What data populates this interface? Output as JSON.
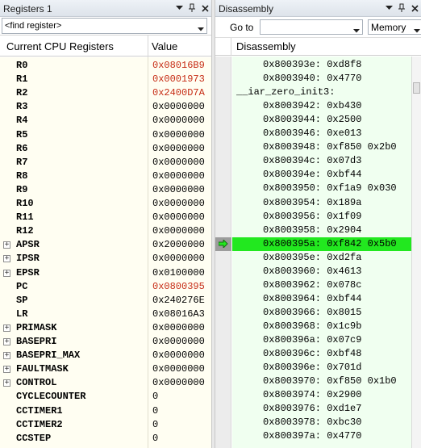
{
  "registers": {
    "title": "Registers 1",
    "find_placeholder": "<find register>",
    "col_name": "Current CPU Registers",
    "col_value": "Value",
    "rows": [
      {
        "name": "R0",
        "value": "0x08016B9",
        "expand": "",
        "changed": true
      },
      {
        "name": "R1",
        "value": "0x0001973",
        "expand": "",
        "changed": true
      },
      {
        "name": "R2",
        "value": "0x2400D7A",
        "expand": "",
        "changed": true
      },
      {
        "name": "R3",
        "value": "0x0000000",
        "expand": "",
        "changed": false
      },
      {
        "name": "R4",
        "value": "0x0000000",
        "expand": "",
        "changed": false
      },
      {
        "name": "R5",
        "value": "0x0000000",
        "expand": "",
        "changed": false
      },
      {
        "name": "R6",
        "value": "0x0000000",
        "expand": "",
        "changed": false
      },
      {
        "name": "R7",
        "value": "0x0000000",
        "expand": "",
        "changed": false
      },
      {
        "name": "R8",
        "value": "0x0000000",
        "expand": "",
        "changed": false
      },
      {
        "name": "R9",
        "value": "0x0000000",
        "expand": "",
        "changed": false
      },
      {
        "name": "R10",
        "value": "0x0000000",
        "expand": "",
        "changed": false
      },
      {
        "name": "R11",
        "value": "0x0000000",
        "expand": "",
        "changed": false
      },
      {
        "name": "R12",
        "value": "0x0000000",
        "expand": "",
        "changed": false
      },
      {
        "name": "APSR",
        "value": "0x2000000",
        "expand": "+",
        "changed": false
      },
      {
        "name": "IPSR",
        "value": "0x0000000",
        "expand": "+",
        "changed": false
      },
      {
        "name": "EPSR",
        "value": "0x0100000",
        "expand": "+",
        "changed": false
      },
      {
        "name": "PC",
        "value": "0x0800395",
        "expand": "",
        "changed": true
      },
      {
        "name": "SP",
        "value": "0x240276E",
        "expand": "",
        "changed": false
      },
      {
        "name": "LR",
        "value": "0x08016A3",
        "expand": "",
        "changed": false
      },
      {
        "name": "PRIMASK",
        "value": "0x0000000",
        "expand": "+",
        "changed": false
      },
      {
        "name": "BASEPRI",
        "value": "0x0000000",
        "expand": "+",
        "changed": false
      },
      {
        "name": "BASEPRI_MAX",
        "value": "0x0000000",
        "expand": "+",
        "changed": false
      },
      {
        "name": "FAULTMASK",
        "value": "0x0000000",
        "expand": "+",
        "changed": false
      },
      {
        "name": "CONTROL",
        "value": "0x0000000",
        "expand": "+",
        "changed": false
      },
      {
        "name": "CYCLECOUNTER",
        "value": "0",
        "expand": "",
        "changed": false
      },
      {
        "name": "CCTIMER1",
        "value": "0",
        "expand": "",
        "changed": false
      },
      {
        "name": "CCTIMER2",
        "value": "0",
        "expand": "",
        "changed": false
      },
      {
        "name": "CCSTEP",
        "value": "0",
        "expand": "",
        "changed": false
      }
    ]
  },
  "disassembly": {
    "title": "Disassembly",
    "goto_label": "Go to",
    "goto_value": "",
    "memory_label": "Memory",
    "col_header": "Disassembly",
    "rows": [
      {
        "text": "0x800393e: 0xd8f8",
        "kind": "code"
      },
      {
        "text": "0x8003940: 0x4770",
        "kind": "code"
      },
      {
        "text": "__iar_zero_init3:",
        "kind": "label"
      },
      {
        "text": "0x8003942: 0xb430",
        "kind": "code"
      },
      {
        "text": "0x8003944: 0x2500",
        "kind": "code"
      },
      {
        "text": "0x8003946: 0xe013",
        "kind": "code"
      },
      {
        "text": "0x8003948: 0xf850 0x2b0",
        "kind": "code"
      },
      {
        "text": "0x800394c: 0x07d3",
        "kind": "code"
      },
      {
        "text": "0x800394e: 0xbf44",
        "kind": "code"
      },
      {
        "text": "0x8003950: 0xf1a9 0x030",
        "kind": "code"
      },
      {
        "text": "0x8003954: 0x189a",
        "kind": "code"
      },
      {
        "text": "0x8003956: 0x1f09",
        "kind": "code"
      },
      {
        "text": "0x8003958: 0x2904",
        "kind": "code"
      },
      {
        "text": "0x800395a: 0xf842 0x5b0",
        "kind": "current"
      },
      {
        "text": "0x800395e: 0xd2fa",
        "kind": "code"
      },
      {
        "text": "0x8003960: 0x4613",
        "kind": "code"
      },
      {
        "text": "0x8003962: 0x078c",
        "kind": "code"
      },
      {
        "text": "0x8003964: 0xbf44",
        "kind": "code"
      },
      {
        "text": "0x8003966: 0x8015",
        "kind": "code"
      },
      {
        "text": "0x8003968: 0x1c9b",
        "kind": "code"
      },
      {
        "text": "0x800396a: 0x07c9",
        "kind": "code"
      },
      {
        "text": "0x800396c: 0xbf48",
        "kind": "code"
      },
      {
        "text": "0x800396e: 0x701d",
        "kind": "code"
      },
      {
        "text": "0x8003970: 0xf850 0x1b0",
        "kind": "code"
      },
      {
        "text": "0x8003974: 0x2900",
        "kind": "code"
      },
      {
        "text": "0x8003976: 0xd1e7",
        "kind": "code"
      },
      {
        "text": "0x8003978: 0xbc30",
        "kind": "code"
      },
      {
        "text": "0x800397a: 0x4770",
        "kind": "code"
      }
    ]
  },
  "colors": {
    "changed_value": "#c62b14",
    "current_line": "#22e81f",
    "register_bg": "#fffef2",
    "disasm_bg": "#f0fff0"
  },
  "icons": {
    "window_menu": "chevron-down-icon",
    "pin": "pin-icon",
    "close": "close-icon",
    "current_instruction": "arrow-right-icon"
  }
}
